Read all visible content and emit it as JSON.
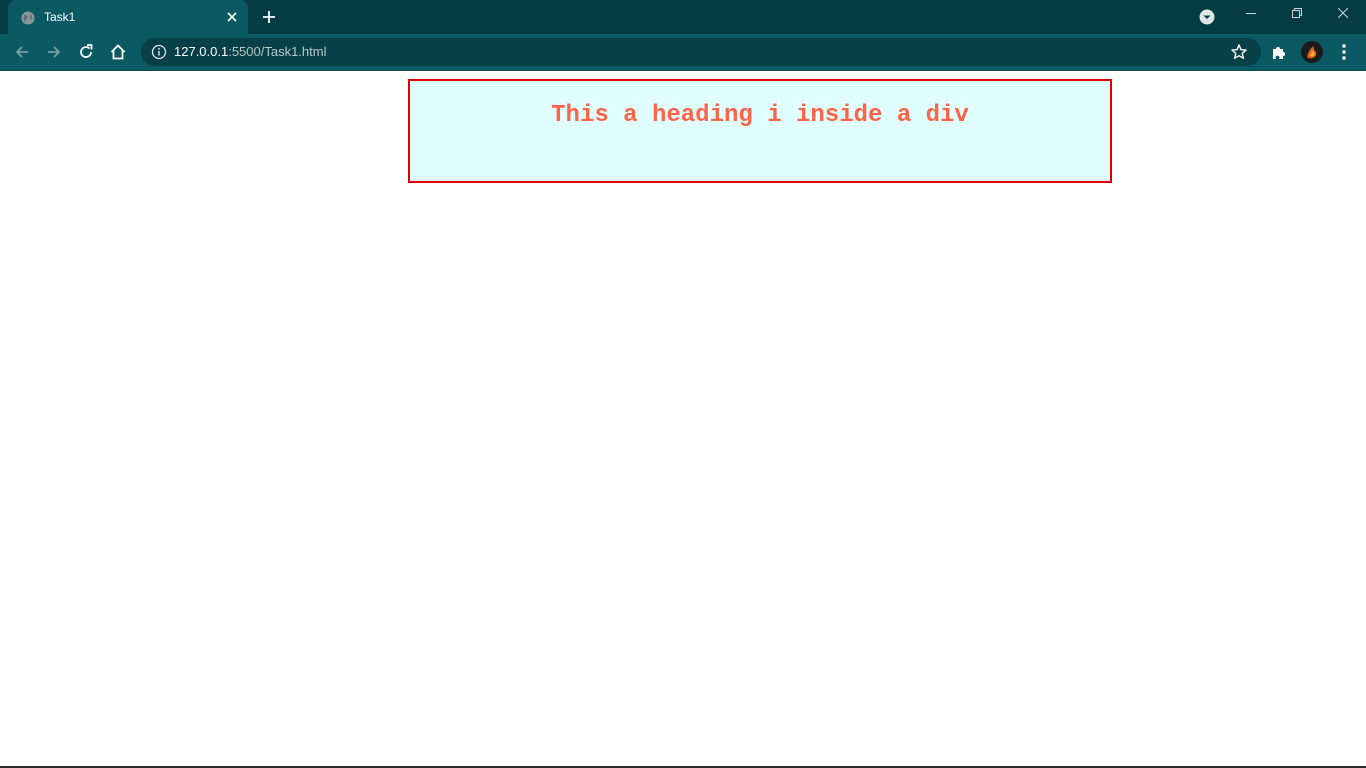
{
  "browser": {
    "tab": {
      "title": "Task1"
    },
    "address": {
      "host": "127.0.0.1",
      "path": ":5500/Task1.html"
    },
    "icons": {
      "back": "back-arrow-icon",
      "forward": "forward-arrow-icon",
      "reload": "reload-icon",
      "home": "home-icon",
      "info": "info-icon",
      "bookmark": "star-icon",
      "extensions": "puzzle-icon",
      "menu": "kebab-menu-icon"
    },
    "colors": {
      "tabstrip": "#053c44",
      "toolbar": "#0b5a63",
      "omnibox": "#074048"
    }
  },
  "page": {
    "heading": "This a heading i inside a div",
    "colors": {
      "heading_text": "#ff6347",
      "box_background": "#e0ffff",
      "box_border": "#e00000"
    }
  }
}
